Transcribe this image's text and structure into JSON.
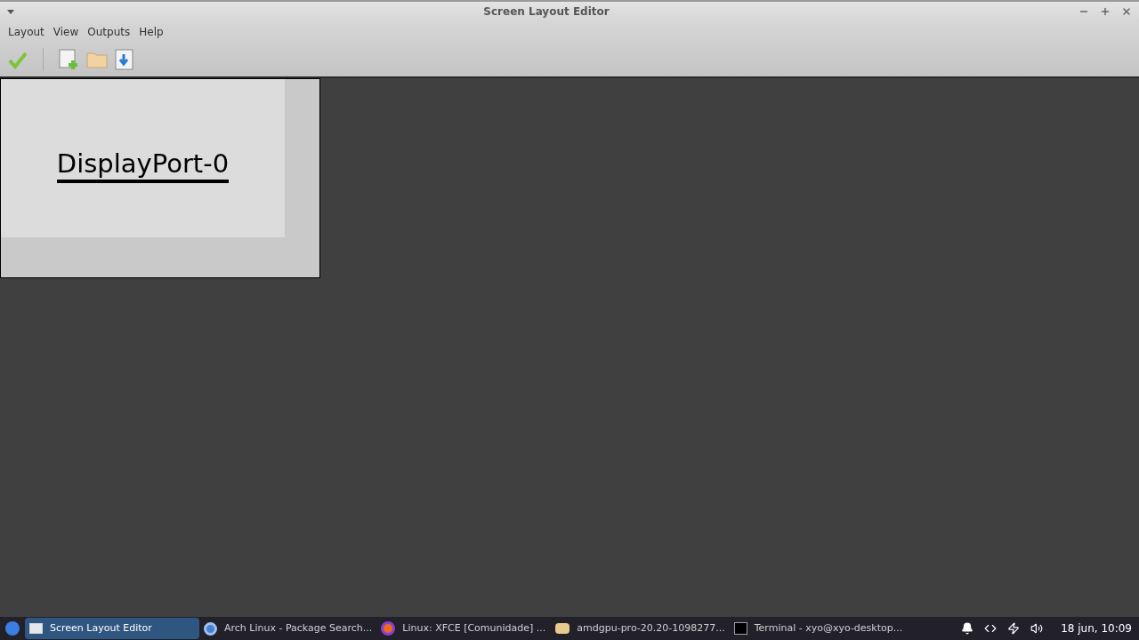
{
  "window": {
    "title": "Screen Layout Editor"
  },
  "menu": [
    "Layout",
    "View",
    "Outputs",
    "Help"
  ],
  "outputs": [
    {
      "name": "DisplayPort-0",
      "selected": true
    }
  ],
  "taskbar": {
    "tasks": [
      {
        "label": "Screen Layout Editor",
        "kind": "window",
        "selected": true
      },
      {
        "label": "Arch Linux - Package Search...",
        "kind": "browser",
        "selected": false
      },
      {
        "label": "Linux: XFCE [Comunidade] ...",
        "kind": "firefox",
        "selected": false
      },
      {
        "label": "amdgpu-pro-20.20-1098277...",
        "kind": "folder",
        "selected": false
      },
      {
        "label": "Terminal - xyo@xyo-desktop...",
        "kind": "terminal",
        "selected": false
      }
    ],
    "clock": "18 jun, 10:09"
  }
}
